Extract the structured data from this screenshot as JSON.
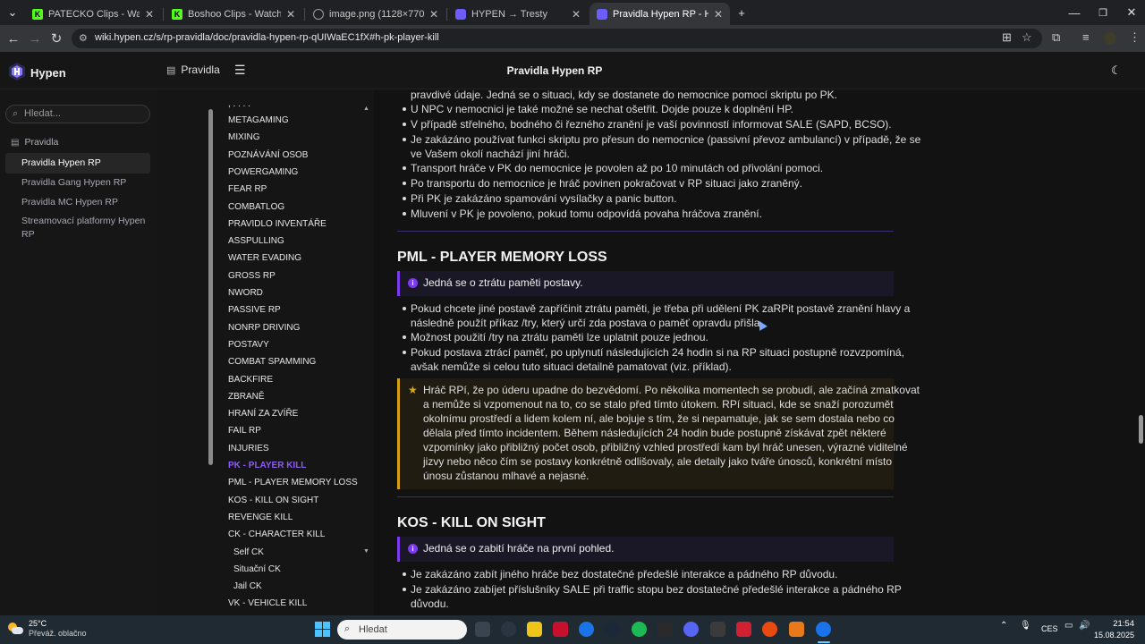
{
  "browser": {
    "tabs": [
      {
        "title": "PATECKO Clips - Watch Live on",
        "favicon": "K",
        "favicon_color": "#53fc18",
        "active": false
      },
      {
        "title": "Boshoo Clips - Watch Live on K",
        "favicon": "K",
        "favicon_color": "#53fc18",
        "active": false
      },
      {
        "title": "image.png (1128×770)",
        "favicon": "globe",
        "favicon_color": "#9aa0a6",
        "active": false
      },
      {
        "title": "HYPEN → Tresty",
        "favicon": "hypen",
        "favicon_color": "#6d5dfc",
        "active": false
      },
      {
        "title": "Pravidla Hypen RP - Hypen",
        "favicon": "hypen",
        "favicon_color": "#6d5dfc",
        "active": true
      }
    ],
    "url": "wiki.hypen.cz/s/rp-pravidla/doc/pravidla-hypen-rp-qUIWaEC1fX#h-pk-player-kill"
  },
  "app": {
    "brand": "Hypen",
    "header_link": "Pravidla",
    "page_title": "Pravidla Hypen RP"
  },
  "sidebar": {
    "search_placeholder": "Hledat...",
    "root": "Pravidla",
    "items": [
      {
        "label": "Pravidla Hypen RP",
        "active": true
      },
      {
        "label": "Pravidla Gang Hypen RP",
        "active": false
      },
      {
        "label": "Pravidla MC Hypen RP",
        "active": false
      },
      {
        "label": "Streamovací platformy Hypen",
        "label2": "RP",
        "active": false
      }
    ]
  },
  "toc": {
    "top_fragment": ", . . . .",
    "items": [
      {
        "label": "METAGAMING"
      },
      {
        "label": "MIXING"
      },
      {
        "label": "POZNÁVÁNÍ OSOB"
      },
      {
        "label": "POWERGAMING"
      },
      {
        "label": "FEAR RP"
      },
      {
        "label": "COMBATLOG"
      },
      {
        "label": "PRAVIDLO INVENTÁŘE"
      },
      {
        "label": "ASSPULLING"
      },
      {
        "label": "WATER EVADING"
      },
      {
        "label": "GROSS RP"
      },
      {
        "label": "NWORD"
      },
      {
        "label": "PASSIVE RP"
      },
      {
        "label": "NONRP DRIVING"
      },
      {
        "label": "POSTAVY"
      },
      {
        "label": "COMBAT SPAMMING"
      },
      {
        "label": "BACKFIRE"
      },
      {
        "label": "ZBRANĚ"
      },
      {
        "label": "HRANÍ ZA ZVÍŘE"
      },
      {
        "label": "FAIL RP"
      },
      {
        "label": "INJURIES"
      },
      {
        "label": "PK - PLAYER KILL",
        "active": true
      },
      {
        "label": "PML - PLAYER MEMORY LOSS"
      },
      {
        "label": "KOS - KILL ON SIGHT"
      },
      {
        "label": "REVENGE KILL"
      },
      {
        "label": "CK - CHARACTER KILL"
      },
      {
        "label": "Self CK",
        "sub": true
      },
      {
        "label": "Situační CK",
        "sub": true
      },
      {
        "label": "Jail CK",
        "sub": true
      },
      {
        "label": "VK - VEHICLE KILL"
      }
    ]
  },
  "content": {
    "pk_continuation": "pravdivé údaje. Jedná se o situaci, kdy se dostanete do nemocnice pomocí skriptu po PK.",
    "pk_bullets": [
      "U NPC v nemocnici je také možné se nechat ošetřit. Dojde pouze k doplnění HP.",
      "V případě střelného, bodného či řezného zranění je vaší povinností informovat SALE (SAPD, BCSO).",
      "Je zakázáno používat funkci skriptu pro přesun do nemocnice (passivní převoz ambulancí) v případě, že se",
      "Transport hráče v PK do nemocnice je povolen až po 10 minutách od přivolání pomoci.",
      "Po transportu do nemocnice je hráč povinen pokračovat v RP situaci jako zraněný.",
      "Při PK je zakázáno spamování vysílačky a panic button.",
      "Mluvení v PK je povoleno, pokud tomu odpovídá povaha hráčova zranění."
    ],
    "pk_bullet3_line2": "ve Vašem okolí nachází jiní hráči.",
    "pml": {
      "heading": "PML - PLAYER MEMORY LOSS",
      "info": "Jedná se o ztrátu paměti postavy.",
      "bullets": [
        [
          "Pokud chcete jiné postavě zapříčinit ztrátu paměti, je třeba při udělení PK zaRPit postavě zranění hlavy a",
          "následně použít příkaz /try, který určí zda postava o paměť opravdu přišla."
        ],
        [
          "Možnost použití /try na ztrátu paměti lze uplatnit pouze jednou."
        ],
        [
          "Pokud postava ztrácí paměť, po uplynutí následujících 24 hodin si na RP situaci postupně rozvzpomíná,",
          "avšak nemůže si celou tuto situaci detailně pamatovat (viz. příklad)."
        ]
      ],
      "example": [
        "Hráč RPí, že po úderu upadne do bezvědomí. Po několika momentech se probudí, ale začíná zmatkovat",
        "a nemůže si vzpomenout na to, co se stalo před tímto útokem. RPí situaci, kde se snaží porozumět",
        "okolnímu prostředí a lidem kolem ní, ale bojuje s tím, že si nepamatuje, jak se sem dostala nebo co",
        "dělala před tímto incidentem. Během následujících 24 hodin bude postupně získávat zpět některé",
        "vzpomínky jako přibližný počet osob, přibližný vzhled prostředí kam byl hráč unesen, výrazné viditelné",
        "jizvy nebo něco čím se postavy konkrétně odlišovaly, ale detaily jako tváře únosců, konkrétní místo",
        "únosu zůstanou mlhavé a nejasné."
      ]
    },
    "kos": {
      "heading": "KOS - KILL ON SIGHT",
      "info": "Jedná se o zabití hráče na první pohled.",
      "bullets": [
        [
          "Je zakázáno zabít jiného hráče bez dostatečné předešlé interakce a pádného RP důvodu."
        ],
        [
          "Je zakázáno zabíjet příslušníky SALE při traffic stopu bez dostatečné předešlé interakce a pádného RP",
          "důvodu."
        ]
      ]
    }
  },
  "taskbar": {
    "weather_temp": "25°C",
    "weather_desc": "Převáž. oblačno",
    "search_placeholder": "Hledat",
    "lang": "CES",
    "time": "21:54",
    "date": "15.08.2025",
    "apps": [
      "file-explorer-icon",
      "chrome-icon",
      "steam-icon",
      "spotify-icon",
      "epic-icon",
      "discord-icon",
      "app-icon",
      "app-red-icon",
      "ea-icon",
      "app-orange-icon",
      "chrome-active-icon"
    ]
  }
}
